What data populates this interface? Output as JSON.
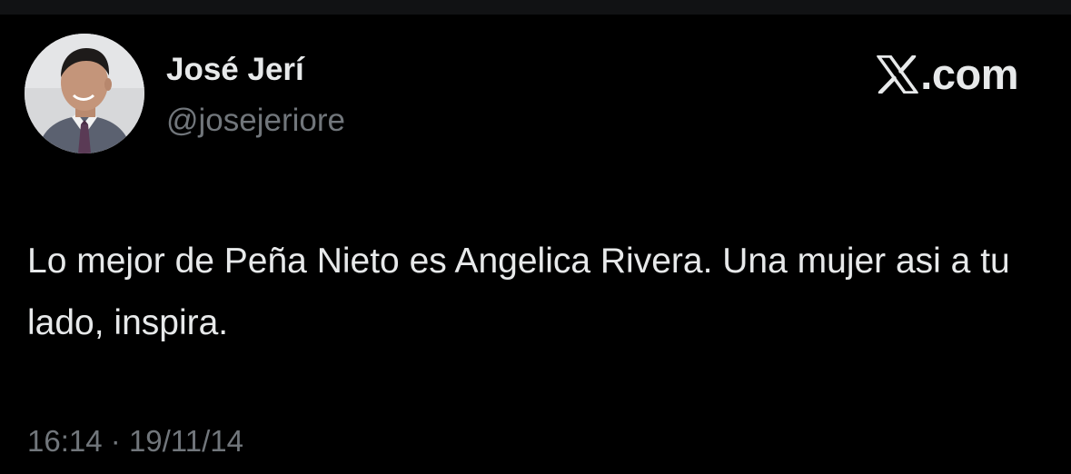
{
  "tweet": {
    "author": {
      "name": "José Jerí",
      "handle": "@josejeriore",
      "avatar": "profile-photo"
    },
    "brand": {
      "icon": "x-logo-icon",
      "suffix": ".com"
    },
    "text": "Lo mejor de Peña Nieto es Angelica Rivera. Una mujer asi a tu lado, inspira.",
    "time": "16:14",
    "separator": "·",
    "date": "19/11/14"
  },
  "colors": {
    "background": "#000000",
    "primary_text": "#e7e9ea",
    "secondary_text": "#71767b"
  }
}
